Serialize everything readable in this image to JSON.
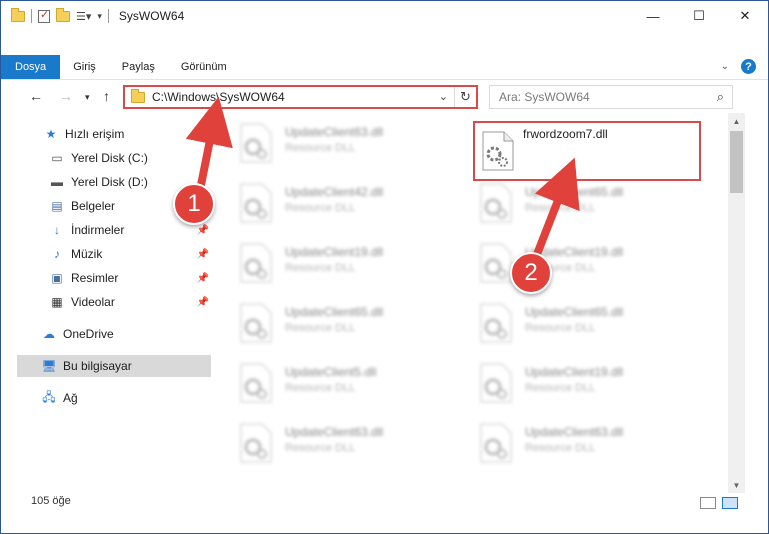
{
  "window": {
    "title": "SysWOW64"
  },
  "ribbon": {
    "tabs": [
      "Dosya",
      "Giriş",
      "Paylaş",
      "Görünüm"
    ],
    "active_tab": "Dosya"
  },
  "address": {
    "path": "C:\\Windows\\SysWOW64",
    "search_placeholder": "Ara: SysWOW64"
  },
  "sidebar": {
    "items": [
      {
        "label": "Hızlı erişim",
        "icon": "star-icon"
      },
      {
        "label": "Yerel Disk (C:)",
        "icon": "drive-icon"
      },
      {
        "label": "Yerel Disk (D:)",
        "icon": "drive-icon"
      },
      {
        "label": "Belgeler",
        "icon": "document-icon"
      },
      {
        "label": "İndirmeler",
        "icon": "download-icon"
      },
      {
        "label": "Müzik",
        "icon": "music-icon"
      },
      {
        "label": "Resimler",
        "icon": "pictures-icon"
      },
      {
        "label": "Videolar",
        "icon": "video-icon"
      },
      {
        "label": "OneDrive",
        "icon": "cloud-icon"
      },
      {
        "label": "Bu bilgisayar",
        "icon": "computer-icon"
      },
      {
        "label": "Ağ",
        "icon": "network-icon"
      }
    ],
    "selected": "Bu bilgisayar"
  },
  "files": {
    "left": [
      {
        "name": "UpdateClient63.dll",
        "type": "Resource DLL"
      },
      {
        "name": "UpdateClient42.dll",
        "type": "Resource DLL"
      },
      {
        "name": "UpdateClient19.dll",
        "type": "Resource DLL"
      },
      {
        "name": "UpdateClient65.dll",
        "type": "Resource DLL"
      },
      {
        "name": "UpdateClient5.dll",
        "type": "Resource DLL"
      },
      {
        "name": "UpdateClient63.dll",
        "type": "Resource DLL"
      }
    ],
    "right": [
      {
        "name": "frwordzoom7.dll",
        "type": ""
      },
      {
        "name": "UpdateClient65.dll",
        "type": "Resource DLL"
      },
      {
        "name": "UpdateClient19.dll",
        "type": "Resource DLL"
      },
      {
        "name": "UpdateClient65.dll",
        "type": "Resource DLL"
      },
      {
        "name": "UpdateClient19.dll",
        "type": "Resource DLL"
      },
      {
        "name": "UpdateClient63.dll",
        "type": "Resource DLL"
      }
    ]
  },
  "status": {
    "count": "105 öğe"
  },
  "annotations": {
    "step1": "1",
    "step2": "2",
    "color": "#e0413b"
  }
}
